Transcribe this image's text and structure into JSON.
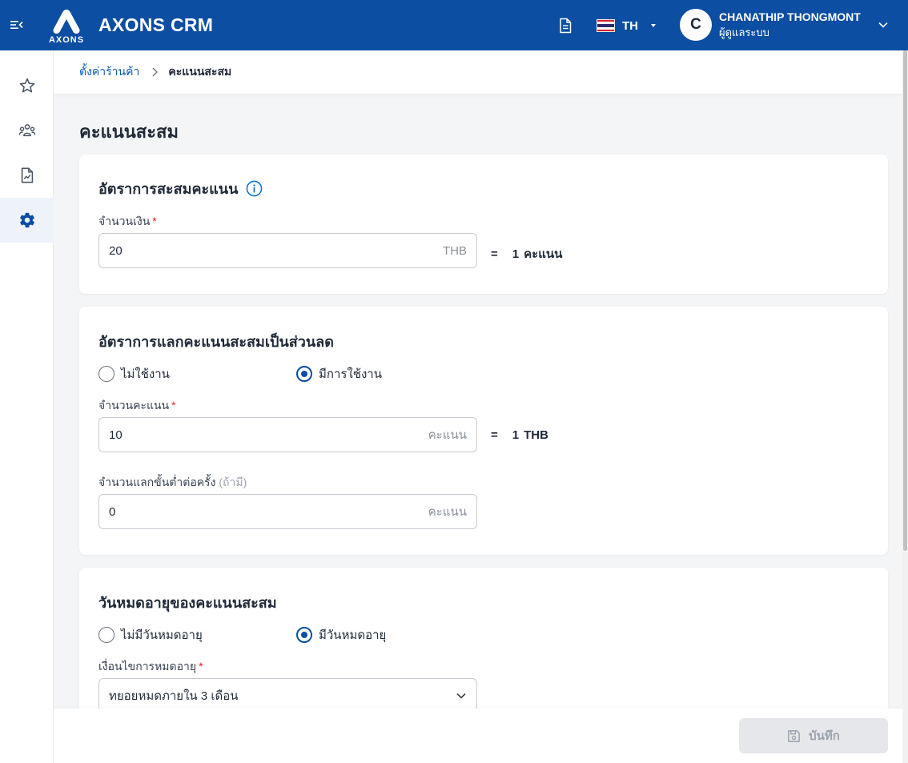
{
  "header": {
    "app_title": "AXONS CRM",
    "logo_text": "AXONS",
    "language": "TH",
    "user_initial": "C",
    "user_name": "CHANATHIP THONGMONT",
    "user_role": "ผู้ดูแลระบบ",
    "brand_color": "#0b4ea2"
  },
  "sidebar": {
    "items": [
      {
        "icon": "star-icon",
        "active": false
      },
      {
        "icon": "users-icon",
        "active": false
      },
      {
        "icon": "report-icon",
        "active": false
      },
      {
        "icon": "gear-icon",
        "active": true
      }
    ]
  },
  "breadcrumb": {
    "parent": "ตั้งค่าร้านค้า",
    "current": "คะแนนสะสม"
  },
  "page_title": "คะแนนสะสม",
  "earn_rate": {
    "title": "อัตราการสะสมคะแนน",
    "amount_label": "จำนวนเงิน",
    "required_mark": "*",
    "amount_value": "20",
    "amount_suffix": "THB",
    "equals": "=",
    "result_number": "1",
    "result_unit": "คะแนน"
  },
  "redeem_rate": {
    "title": "อัตราการแลกคะแนนสะสมเป็นส่วนลด",
    "option_disabled": "ไม่ใช้งาน",
    "option_enabled": "มีการใช้งาน",
    "selected": "enabled",
    "points_label": "จำนวนคะแนน",
    "required_mark": "*",
    "points_value": "10",
    "points_suffix": "คะแนน",
    "equals": "=",
    "result_number": "1",
    "result_unit": "THB",
    "min_label": "จำนวนแลกขั้นต่ำต่อครั้ง",
    "min_optional": "(ถ้ามี)",
    "min_value": "0",
    "min_suffix": "คะแนน"
  },
  "expiry": {
    "title": "วันหมดอายุของคะแนนสะสม",
    "option_none": "ไม่มีวันหมดอายุ",
    "option_has": "มีวันหมดอายุ",
    "selected": "has",
    "condition_label": "เงื่อนไขการหมดอายุ",
    "required_mark": "*",
    "condition_value": "ทยอยหมดภายใน 3 เดือน"
  },
  "footer": {
    "save_label": "บันทึก"
  }
}
